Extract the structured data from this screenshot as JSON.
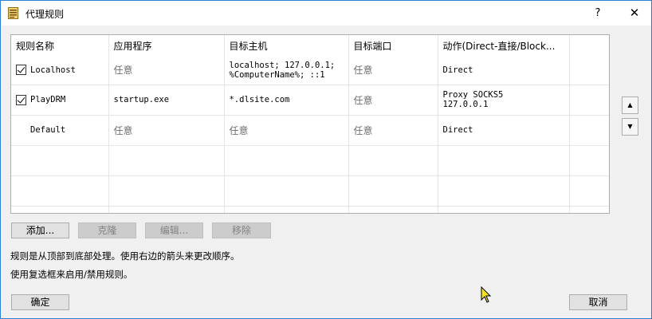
{
  "window": {
    "title": "代理规则",
    "help": "?",
    "close": "✕"
  },
  "table": {
    "headers": [
      "规则名称",
      "应用程序",
      "目标主机",
      "目标端口",
      "动作(Direct-直接/Block..."
    ],
    "rows": [
      {
        "checked": true,
        "name": "Localhost",
        "app": "任意",
        "host_line1": "localhost; 127.0.0.1;",
        "host_line2": "%ComputerName%; ::1",
        "port": "任意",
        "action_line1": "Direct",
        "action_line2": ""
      },
      {
        "checked": true,
        "name": "PlayDRM",
        "app": "startup.exe",
        "host_line1": "*.dlsite.com",
        "host_line2": "",
        "port": "任意",
        "action_line1": "Proxy SOCKS5",
        "action_line2": "127.0.0.1"
      },
      {
        "checked": false,
        "name": "Default",
        "app": "任意",
        "host_line1": "任意",
        "host_line2": "",
        "port": "任意",
        "action_line1": "Direct",
        "action_line2": ""
      }
    ]
  },
  "buttons": {
    "add": "添加...",
    "clone": "克隆",
    "edit": "编辑...",
    "remove": "移除",
    "ok": "确定",
    "cancel": "取消"
  },
  "info": {
    "line1": "规则是从顶部到底部处理。使用右边的箭头来更改顺序。",
    "line2": "使用复选框来启用/禁用规则。"
  }
}
